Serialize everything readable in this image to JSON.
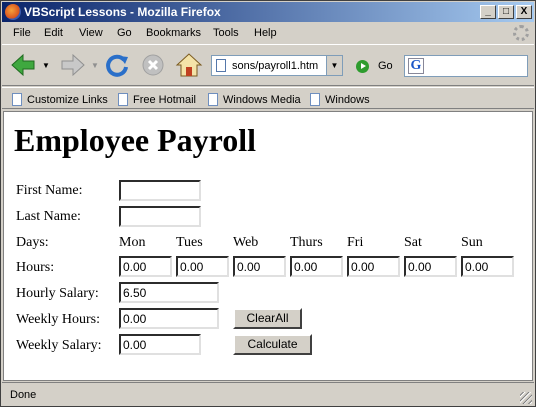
{
  "window": {
    "title": "VBScript Lessons - Mozilla Firefox",
    "minimize": "_",
    "maximize": "□",
    "close": "X"
  },
  "menu": [
    "File",
    "Edit",
    "View",
    "Go",
    "Bookmarks",
    "Tools",
    "Help"
  ],
  "nav": {
    "url": "sons/payroll1.htm",
    "go_label": "Go",
    "search_value": "",
    "search_engine_icon": "G"
  },
  "bookmarks": [
    "Customize Links",
    "Free Hotmail",
    "Windows Media",
    "Windows"
  ],
  "page": {
    "heading": "Employee Payroll",
    "first_name_label": "First Name:",
    "first_name_value": "",
    "last_name_label": "Last Name:",
    "last_name_value": "",
    "days_label": "Days:",
    "hours_label": "Hours:",
    "days": [
      {
        "name": "Mon",
        "hours": "0.00"
      },
      {
        "name": "Tues",
        "hours": "0.00"
      },
      {
        "name": "Web",
        "hours": "0.00"
      },
      {
        "name": "Thurs",
        "hours": "0.00"
      },
      {
        "name": "Fri",
        "hours": "0.00"
      },
      {
        "name": "Sat",
        "hours": "0.00"
      },
      {
        "name": "Sun",
        "hours": "0.00"
      }
    ],
    "hourly_salary_label": "Hourly Salary:",
    "hourly_salary_value": "6.50",
    "weekly_hours_label": "Weekly Hours:",
    "weekly_hours_value": "0.00",
    "weekly_salary_label": "Weekly Salary:",
    "weekly_salary_value": "0.00",
    "clear_all_label": "ClearAll",
    "calculate_label": "Calculate"
  },
  "status": {
    "text": "Done"
  }
}
